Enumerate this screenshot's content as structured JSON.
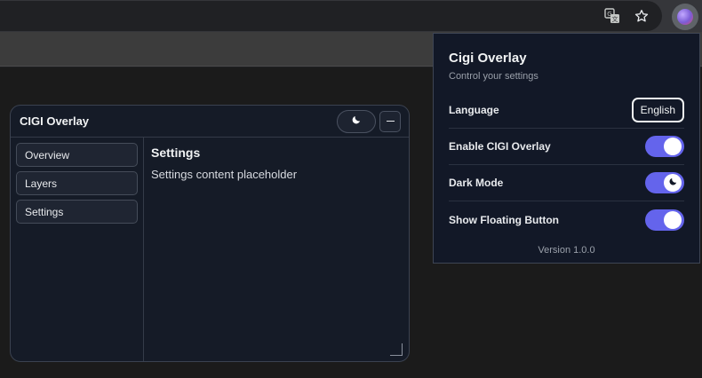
{
  "browser": {
    "icons": {
      "translate": "translate-icon",
      "bookmark": "star-icon",
      "extension": "extension-avatar-icon"
    }
  },
  "overlay": {
    "title": "CIGI Overlay",
    "theme_icon": "moon-icon",
    "minimize_icon": "minimize-icon",
    "nav": [
      {
        "label": "Overview"
      },
      {
        "label": "Layers"
      },
      {
        "label": "Settings"
      }
    ],
    "content": {
      "title": "Settings",
      "text": "Settings content placeholder"
    }
  },
  "popup": {
    "title": "Cigi Overlay",
    "subtitle": "Control your settings",
    "language": {
      "label": "Language",
      "value": "English"
    },
    "toggles": [
      {
        "label": "Enable CIGI Overlay",
        "on": true
      },
      {
        "label": "Dark Mode",
        "on": true,
        "icon": "moon-icon"
      },
      {
        "label": "Show Floating Button",
        "on": true
      }
    ],
    "version": "Version 1.0.0"
  },
  "colors": {
    "accent": "#6464ec",
    "panel_bg": "#151b27",
    "popup_bg": "#121827"
  }
}
